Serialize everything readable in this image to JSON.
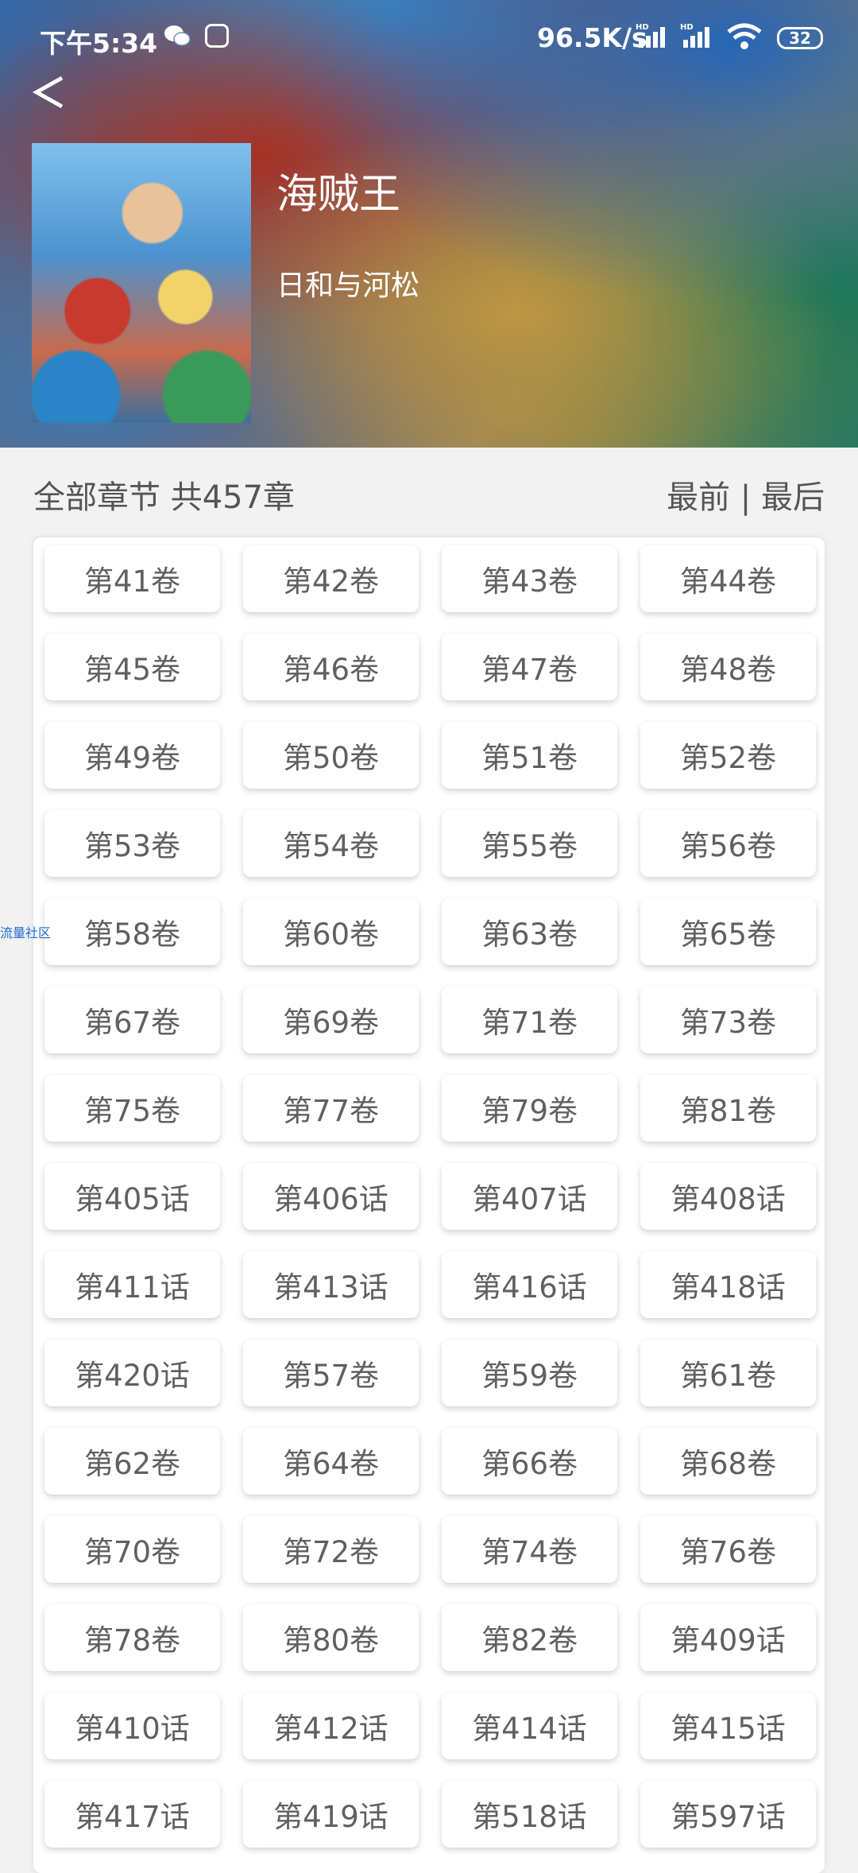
{
  "status_bar": {
    "time": "下午5:34",
    "net_speed": "96.5K/s",
    "battery": "32"
  },
  "comic": {
    "title": "海贼王",
    "author": "日和与河松"
  },
  "chapters_header": {
    "title": "全部章节 共457章",
    "sort": "最前 | 最后"
  },
  "side_tag": "流量社区",
  "chapters": [
    "第41卷",
    "第42卷",
    "第43卷",
    "第44卷",
    "第45卷",
    "第46卷",
    "第47卷",
    "第48卷",
    "第49卷",
    "第50卷",
    "第51卷",
    "第52卷",
    "第53卷",
    "第54卷",
    "第55卷",
    "第56卷",
    "第58卷",
    "第60卷",
    "第63卷",
    "第65卷",
    "第67卷",
    "第69卷",
    "第71卷",
    "第73卷",
    "第75卷",
    "第77卷",
    "第79卷",
    "第81卷",
    "第405话",
    "第406话",
    "第407话",
    "第408话",
    "第411话",
    "第413话",
    "第416话",
    "第418话",
    "第420话",
    "第57卷",
    "第59卷",
    "第61卷",
    "第62卷",
    "第64卷",
    "第66卷",
    "第68卷",
    "第70卷",
    "第72卷",
    "第74卷",
    "第76卷",
    "第78卷",
    "第80卷",
    "第82卷",
    "第409话",
    "第410话",
    "第412话",
    "第414话",
    "第415话",
    "第417话",
    "第419话",
    "第518话",
    "第597话"
  ]
}
